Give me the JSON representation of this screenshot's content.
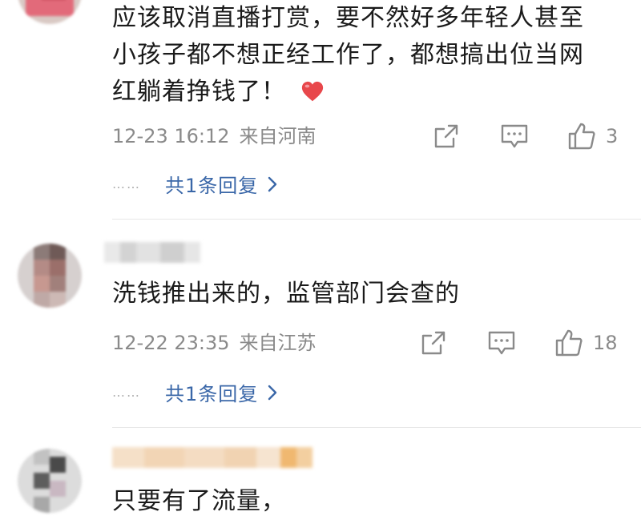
{
  "colors": {
    "text": "#1a1a1a",
    "meta": "#8a8a8a",
    "link": "#3a67a8",
    "heart": "#e8474b",
    "divider": "#e6e6e6"
  },
  "comments": [
    {
      "text_lines": [
        "应该取消直播打赏，要不然好多年轻人甚至",
        "小孩子都不想正经工作了，都想搞出位当网",
        "红躺着挣钱了！"
      ],
      "emoji": "heart-emoji",
      "time": "12-23 16:12",
      "location": "来自河南",
      "likes": "3",
      "replies": "共1条回复",
      "dots": "……"
    },
    {
      "text_lines": [
        "洗钱推出来的，监管部门会查的"
      ],
      "time": "12-22 23:35",
      "location": "来自江苏",
      "likes": "18",
      "replies": "共1条回复",
      "dots": "……"
    },
    {
      "text_lines": [
        "只要有了流量，"
      ]
    }
  ]
}
